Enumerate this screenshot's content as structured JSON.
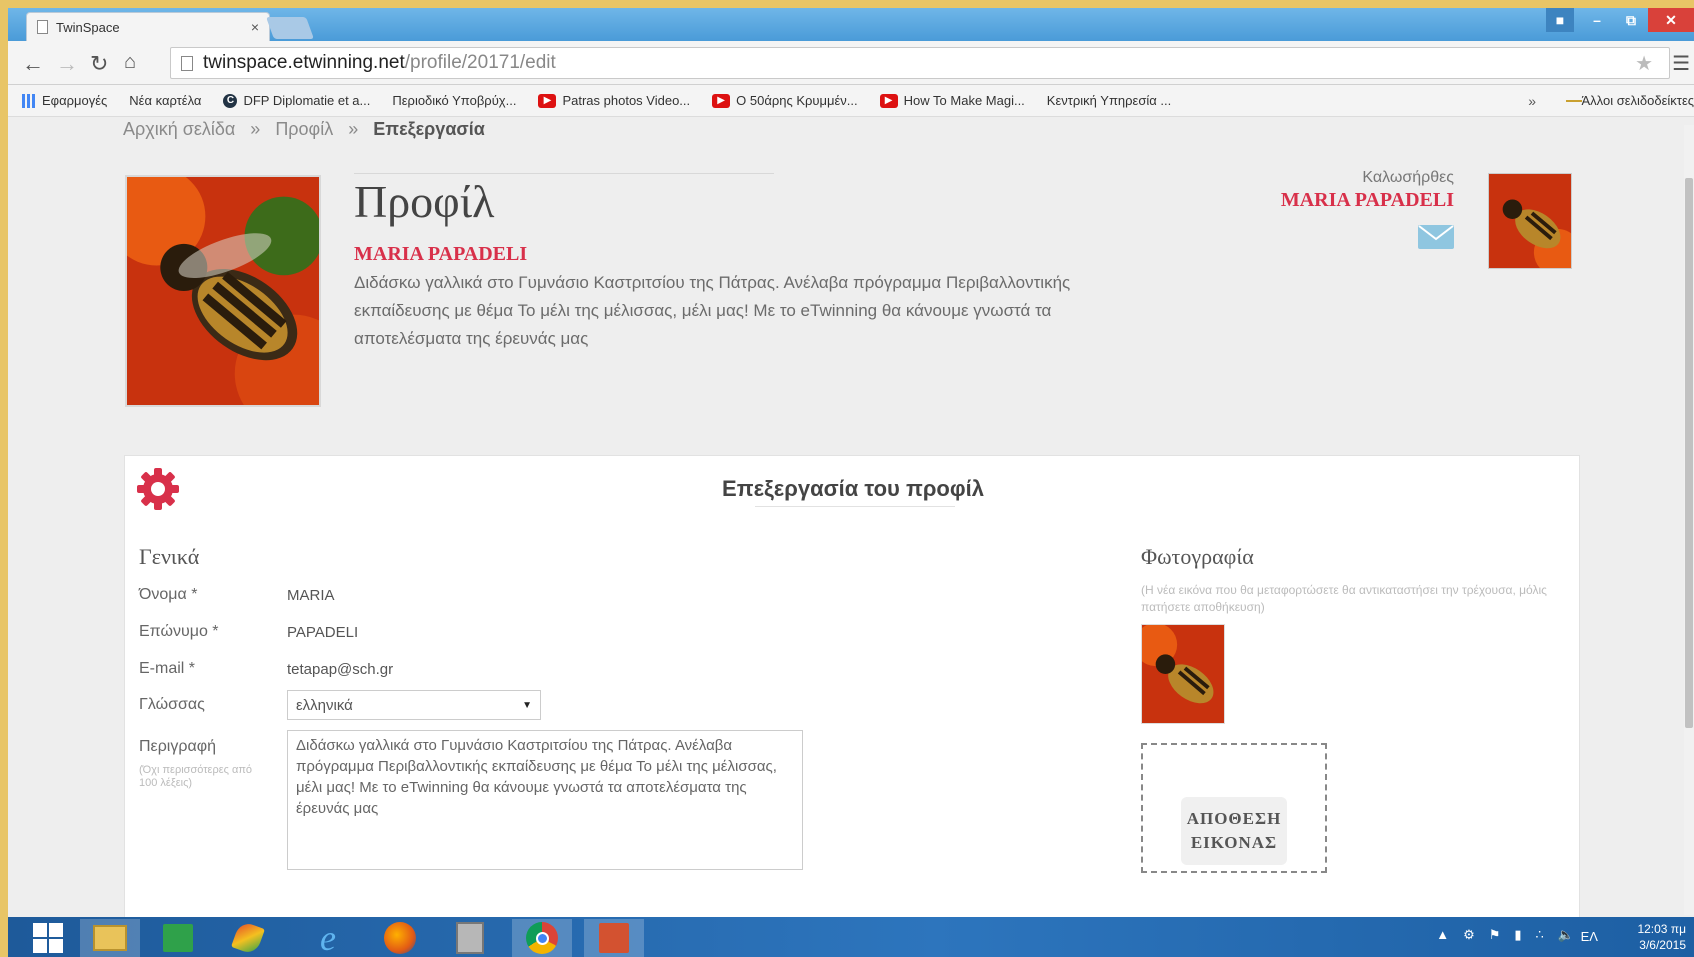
{
  "browser": {
    "tab_title": "TwinSpace",
    "tab_close": "×",
    "url_host": "twinspace.etwinning.net",
    "url_path": "/profile/20171/edit",
    "bookmarks": [
      {
        "label": "Εφαρμογές",
        "icon": "apps-icon"
      },
      {
        "label": "Νέα καρτέλα",
        "icon": "page-icon"
      },
      {
        "label": "DFP Diplomatie et a...",
        "icon": "dfp-icon"
      },
      {
        "label": "Περιοδικό Υποβρύχ...",
        "icon": "page-icon"
      },
      {
        "label": "Patras photos Video...",
        "icon": "youtube-icon"
      },
      {
        "label": "Ο 50άρης Κρυμμέν...",
        "icon": "youtube-icon"
      },
      {
        "label": "How To Make Magi...",
        "icon": "youtube-icon"
      },
      {
        "label": "Κεντρική Υπηρεσία ...",
        "icon": "page-icon"
      }
    ],
    "bookmarks_more": "»",
    "other_bookmarks": "Άλλοι σελιδοδείκτες"
  },
  "breadcrumb": {
    "home": "Αρχική σελίδα",
    "profile": "Προφίλ",
    "current": "Επεξεργασία",
    "separator": "»"
  },
  "profile": {
    "title": "Προφίλ",
    "name": "MARIA PAPADELI",
    "bio": "Διδάσκω γαλλικά στο Γυμνάσιο Καστριτσίου της Πάτρας. Ανέλαβα πρόγραμμα Περιβαλλοντικής εκπαίδευσης με θέμα Το μέλι της μέλισσας, μέλι μας! Με το eTwinning θα κάνουμε γνωστά τα αποτελέσματα της έρευνάς μας"
  },
  "user": {
    "welcome": "Καλωσήρθες",
    "name": "MARIA PAPADELI"
  },
  "edit": {
    "title": "Επεξεργασία του προφίλ",
    "general": "Γενικά",
    "first_name_label": "Όνομα *",
    "first_name": "MARIA",
    "last_name_label": "Επώνυμο *",
    "last_name": "PAPADELI",
    "email_label": "E-mail *",
    "email": "tetapap@sch.gr",
    "language_label": "Γλώσσας",
    "language": "ελληνικά",
    "description_label": "Περιγραφή",
    "description_hint": "(Όχι περισσότερες από 100 λέξεις)",
    "description": "Διδάσκω γαλλικά στο Γυμνάσιο Καστριτσίου της Πάτρας. Ανέλαβα πρόγραμμα Περιβαλλοντικής εκπαίδευσης με θέμα Το μέλι της μέλισσας, μέλι μας! Με το eTwinning θα κάνουμε γνωστά τα αποτελέσματα της έρευνάς μας",
    "photo_title": "Φωτογραφία",
    "photo_note": "(Η νέα εικόνα που θα μεταφορτώσετε θα αντικαταστήσει την τρέχουσα, μόλις πατήσετε αποθήκευση)",
    "upload_line1": "ΑΠΟΘΕΣΗ",
    "upload_line2": "ΕΙΚΟΝΑΣ"
  },
  "taskbar": {
    "language": "ΕΛ",
    "time": "12:03 πμ",
    "date": "3/6/2015"
  },
  "colors": {
    "accent_red": "#d8304a",
    "taskbar_blue": "#2d75bd",
    "desktop_gold": "#e8c566"
  }
}
